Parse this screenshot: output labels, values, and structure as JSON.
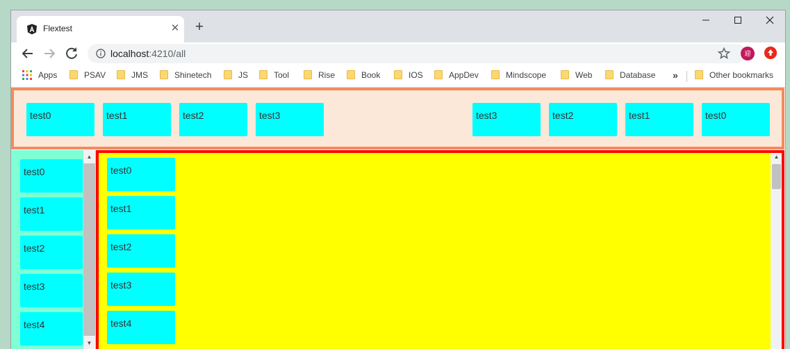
{
  "tab": {
    "title": "Flextest",
    "close_glyph": "✕"
  },
  "new_tab_glyph": "+",
  "window_controls": {
    "minimize": "—",
    "maximize": "☐",
    "close": "✕"
  },
  "address": {
    "host": "localhost",
    "rest": ":4210/all"
  },
  "profile_initial": "迎",
  "bookmarks": {
    "apps_label": "Apps",
    "items": [
      "PSAV",
      "JMS",
      "Shinetech",
      "JS",
      "Tool",
      "Rise",
      "Book",
      "IOS",
      "AppDev",
      "Mindscope",
      "Web",
      "Database"
    ],
    "overflow_glyph": "»",
    "other_label": "Other bookmarks"
  },
  "header_left": [
    "test0",
    "test1",
    "test2",
    "test3"
  ],
  "header_right": [
    "test3",
    "test2",
    "test1",
    "test0"
  ],
  "sidebar_items": [
    "test0",
    "test1",
    "test2",
    "test3",
    "test4"
  ],
  "main_items": [
    "test0",
    "test1",
    "test2",
    "test3",
    "test4"
  ],
  "colors": {
    "header_bg": "#fbe8d9",
    "header_border": "#f58a5d",
    "box": "#00ffff",
    "sidebar_bg": "#7fffd4",
    "main_bg": "#ffff00",
    "main_border": "#ff0000"
  }
}
